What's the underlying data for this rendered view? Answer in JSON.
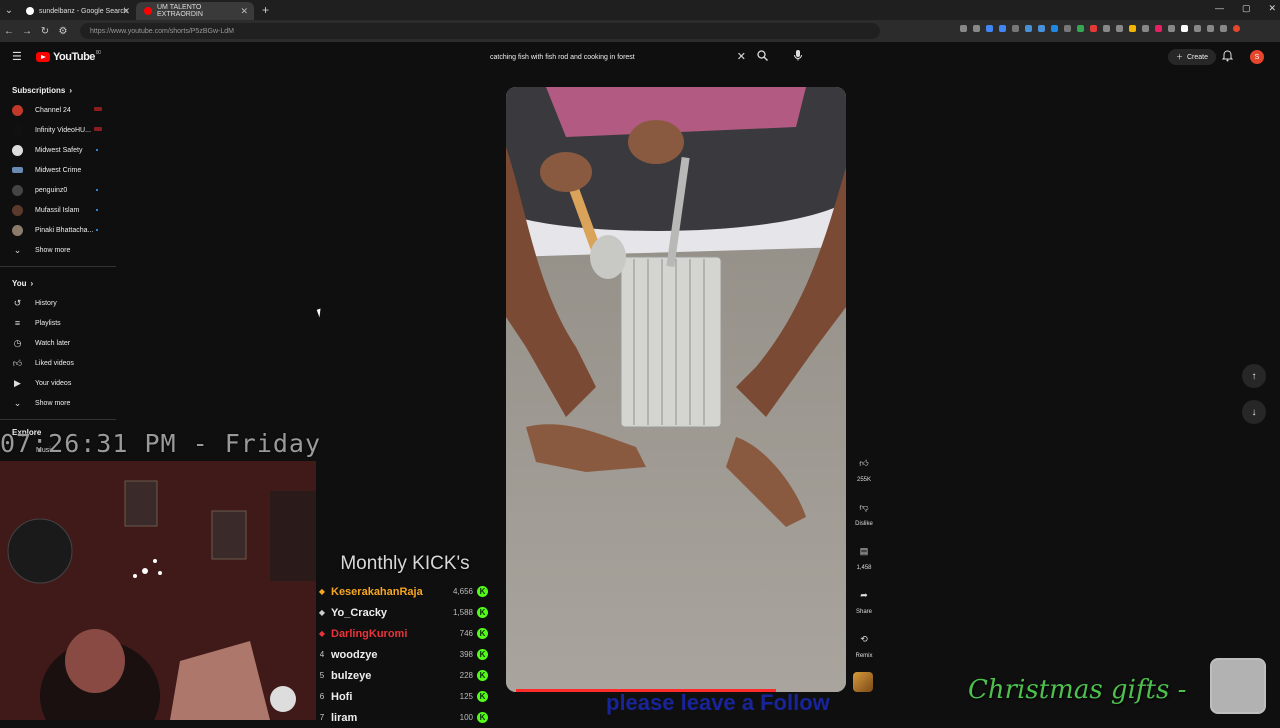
{
  "browser": {
    "tabs": [
      {
        "title": "sundelbanz - Google Search",
        "active": false
      },
      {
        "title": "UM TALENTO EXTRAORDIN",
        "active": true
      }
    ],
    "url": "https://www.youtube.com/shorts/P5zBGw-LdM"
  },
  "header": {
    "logo_text": "YouTube",
    "logo_region": "80",
    "search_value": "catching fish with fish rod and cooking in forest",
    "create_label": "Create",
    "avatar_letter": "S"
  },
  "sidebar": {
    "subscriptions_title": "Subscriptions",
    "channels": [
      {
        "name": "Channel 24",
        "status": "live"
      },
      {
        "name": "Infinity VideoHU...",
        "status": "live"
      },
      {
        "name": "Midwest Safety",
        "status": "new"
      },
      {
        "name": "Midwest Crime",
        "status": ""
      },
      {
        "name": "penguinz0",
        "status": "new"
      },
      {
        "name": "Mufassil Islam",
        "status": "new"
      },
      {
        "name": "Pinaki Bhattacha...",
        "status": "new"
      }
    ],
    "show_more_1": "Show more",
    "you_title": "You",
    "you_items": [
      {
        "label": "History",
        "icon": "history-icon"
      },
      {
        "label": "Playlists",
        "icon": "playlists-icon"
      },
      {
        "label": "Watch later",
        "icon": "watch-later-icon"
      },
      {
        "label": "Liked videos",
        "icon": "liked-icon"
      },
      {
        "label": "Your videos",
        "icon": "your-videos-icon"
      }
    ],
    "show_more_2": "Show more",
    "explore_title": "Explore",
    "music_label": "Music"
  },
  "short": {
    "likes": "255K",
    "dislike_label": "Dislike",
    "comments": "1,458",
    "share_label": "Share",
    "remix_label": "Remix"
  },
  "overlay": {
    "clock": "07:26:31 PM - Friday",
    "kick_title": "Monthly KICK's",
    "kick_rows": [
      {
        "rank": "",
        "name": "KeserakahanRaja",
        "amount": "4,656",
        "color": "#f5a623"
      },
      {
        "rank": "",
        "name": "Yo_Cracky",
        "amount": "1,588",
        "color": "#e8e8e8"
      },
      {
        "rank": "",
        "name": "DarlingKuromi",
        "amount": "746",
        "color": "#e8343a"
      },
      {
        "rank": "4",
        "name": "woodzye",
        "amount": "398",
        "color": "#e8e8e8"
      },
      {
        "rank": "5",
        "name": "bulzeye",
        "amount": "228",
        "color": "#e8e8e8"
      },
      {
        "rank": "6",
        "name": "Hofi",
        "amount": "125",
        "color": "#e8e8e8"
      },
      {
        "rank": "7",
        "name": "liram",
        "amount": "100",
        "color": "#e8e8e8"
      }
    ],
    "follow_message": "please leave a Follow",
    "xmas_text": "Christmas gifts -"
  }
}
